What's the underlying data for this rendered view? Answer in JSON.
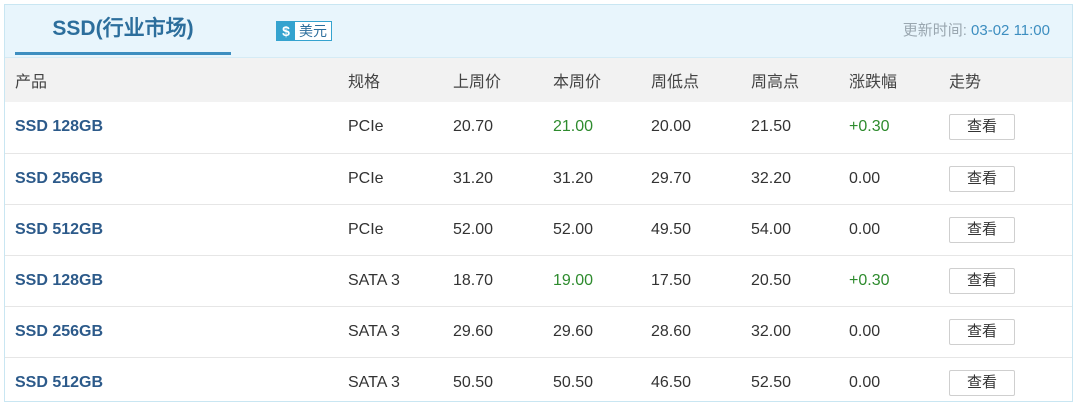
{
  "header": {
    "title": "SSD(行业市场)",
    "currency_symbol": "$",
    "currency_label": "美元",
    "updated_label": "更新时间:",
    "updated_value": "03-02 11:00"
  },
  "table": {
    "columns": [
      "产品",
      "规格",
      "上周价",
      "本周价",
      "周低点",
      "周高点",
      "涨跌幅",
      "走势"
    ],
    "rows": [
      {
        "product": "SSD 128GB",
        "spec": "PCIe",
        "last_week": "20.70",
        "this_week": "21.00",
        "low": "20.00",
        "high": "21.50",
        "change": "+0.30",
        "action": "查看",
        "up": true
      },
      {
        "product": "SSD 256GB",
        "spec": "PCIe",
        "last_week": "31.20",
        "this_week": "31.20",
        "low": "29.70",
        "high": "32.20",
        "change": "0.00",
        "action": "查看",
        "up": false
      },
      {
        "product": "SSD 512GB",
        "spec": "PCIe",
        "last_week": "52.00",
        "this_week": "52.00",
        "low": "49.50",
        "high": "54.00",
        "change": "0.00",
        "action": "查看",
        "up": false
      },
      {
        "product": "SSD 128GB",
        "spec": "SATA 3",
        "last_week": "18.70",
        "this_week": "19.00",
        "low": "17.50",
        "high": "20.50",
        "change": "+0.30",
        "action": "查看",
        "up": true
      },
      {
        "product": "SSD 256GB",
        "spec": "SATA 3",
        "last_week": "29.60",
        "this_week": "29.60",
        "low": "28.60",
        "high": "32.00",
        "change": "0.00",
        "action": "查看",
        "up": false
      },
      {
        "product": "SSD 512GB",
        "spec": "SATA 3",
        "last_week": "50.50",
        "this_week": "50.50",
        "low": "46.50",
        "high": "52.50",
        "change": "0.00",
        "action": "查看",
        "up": false
      }
    ]
  },
  "colors": {
    "title": "#2c6e9c",
    "accent": "#35a3cf",
    "product_text": "#2c5a8a",
    "up": "#2e8b2e",
    "header_bg": "#e8f5fc"
  }
}
